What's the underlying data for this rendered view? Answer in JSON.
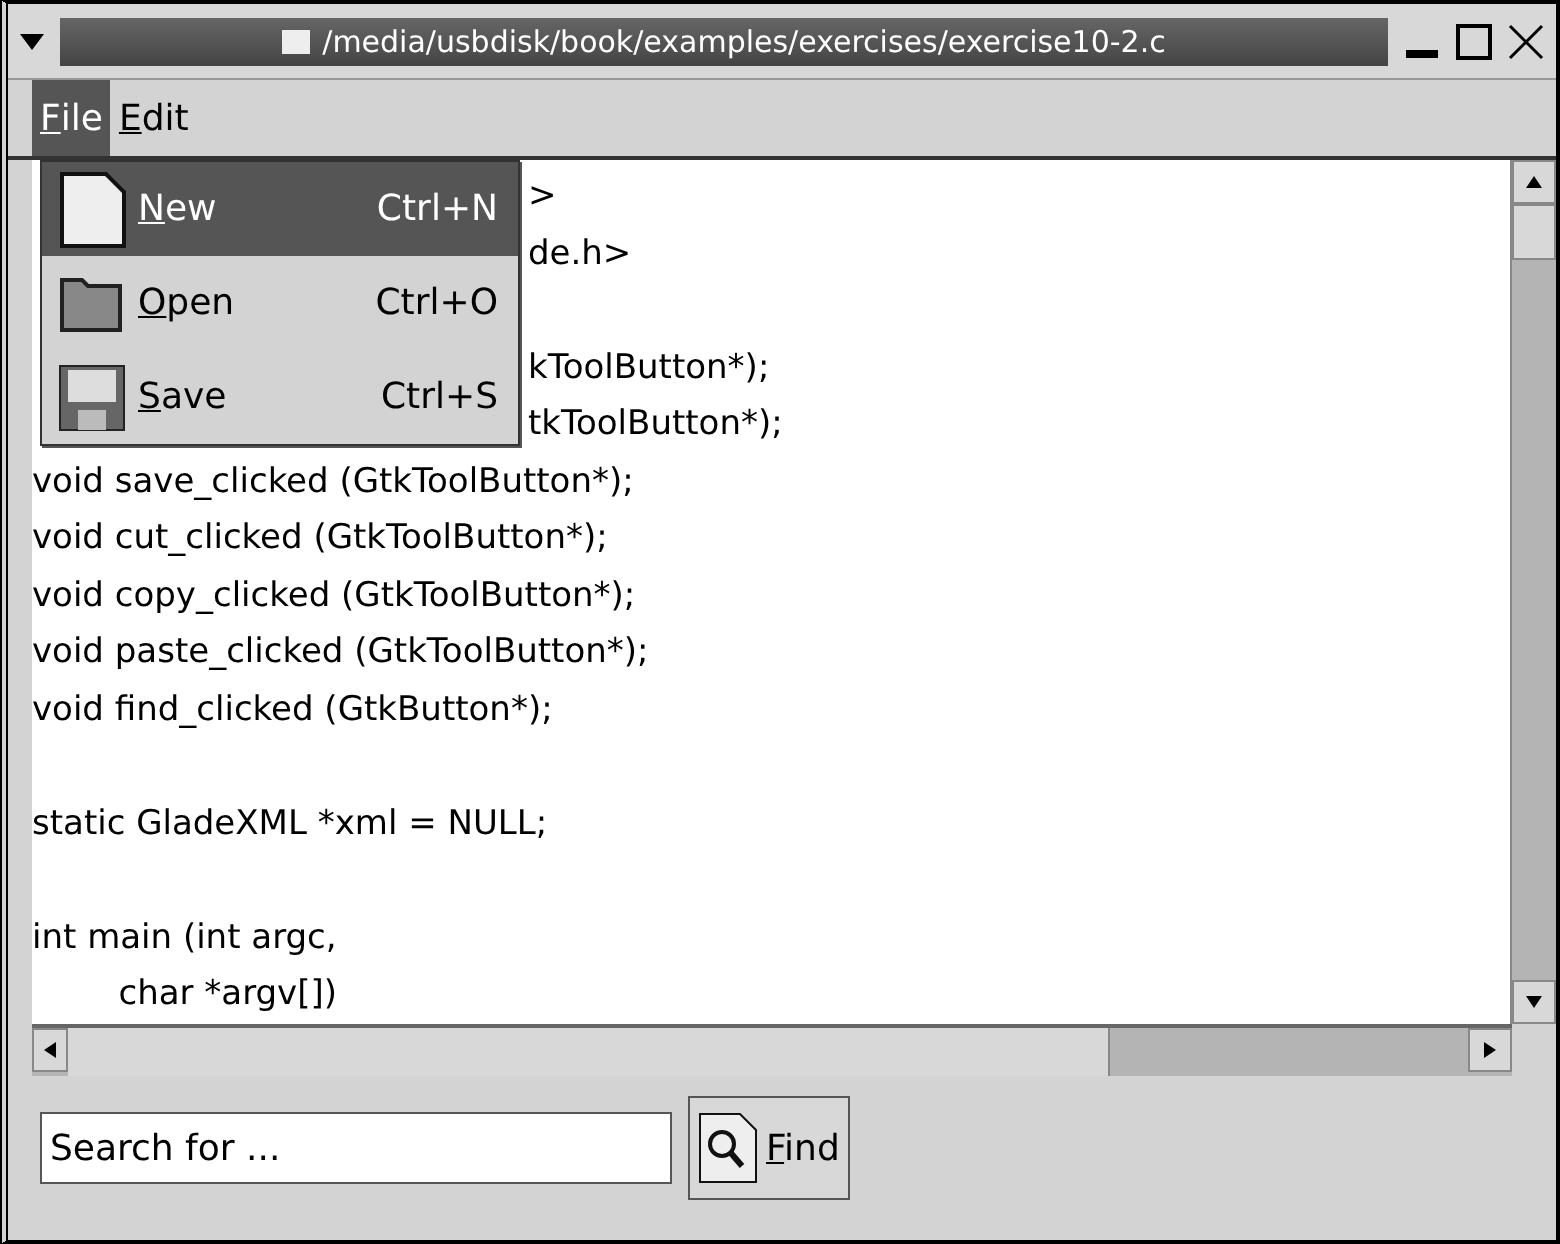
{
  "window": {
    "title": "/media/usbdisk/book/examples/exercises/exercise10-2.c"
  },
  "menubar": [
    {
      "mnemonic": "F",
      "rest": "ile",
      "selected": true
    },
    {
      "mnemonic": "E",
      "rest": "dit",
      "selected": false
    }
  ],
  "file_menu": [
    {
      "kind": "new",
      "mnemonic": "N",
      "rest": "ew",
      "shortcut": "Ctrl+N",
      "selected": true
    },
    {
      "kind": "open",
      "mnemonic": "O",
      "rest": "pen",
      "shortcut": "Ctrl+O",
      "selected": false
    },
    {
      "kind": "save",
      "mnemonic": "S",
      "rest": "ave",
      "shortcut": "Ctrl+S",
      "selected": false
    }
  ],
  "editor_lines": [
    {
      "kind": "fragment",
      "text": ">"
    },
    {
      "kind": "fragment",
      "text": "de.h>"
    },
    {
      "kind": "blank"
    },
    {
      "kind": "fragment",
      "text": "kToolButton*);"
    },
    {
      "kind": "fragment",
      "text": "tkToolButton*);"
    },
    {
      "kind": "code",
      "text": "void save_clicked (GtkToolButton*);"
    },
    {
      "kind": "code",
      "text": "void cut_clicked (GtkToolButton*);"
    },
    {
      "kind": "code",
      "text": "void copy_clicked (GtkToolButton*);"
    },
    {
      "kind": "code",
      "text": "void paste_clicked (GtkToolButton*);"
    },
    {
      "kind": "code",
      "text": "void find_clicked (GtkButton*);"
    },
    {
      "kind": "blank"
    },
    {
      "kind": "code",
      "text": "static GladeXML *xml = NULL;"
    },
    {
      "kind": "blank"
    },
    {
      "kind": "code",
      "text": "int main (int argc,"
    },
    {
      "kind": "code",
      "text": "        char *argv[])"
    }
  ],
  "search": {
    "value": "Search for ..."
  },
  "find_button": {
    "mnemonic": "F",
    "rest": "ind"
  }
}
